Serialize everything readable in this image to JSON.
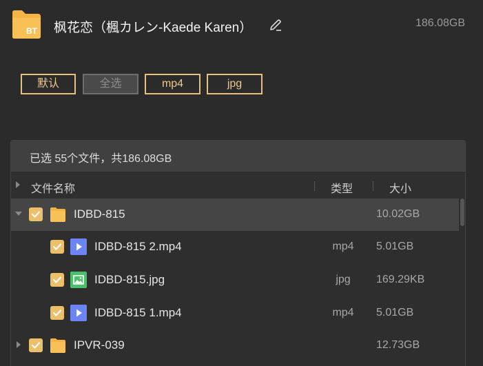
{
  "header": {
    "title": "枫花恋（楓カレン-Kaede Karen）",
    "total_size": "186.08GB",
    "folder_badge": "BT"
  },
  "filters": [
    {
      "label": "默认",
      "state": "active"
    },
    {
      "label": "全选",
      "state": "disabled"
    },
    {
      "label": "mp4",
      "state": "active"
    },
    {
      "label": "jpg",
      "state": "active"
    }
  ],
  "panel": {
    "summary": "已选 55个文件，共186.08GB",
    "columns": {
      "name": "文件名称",
      "type": "类型",
      "size": "大小"
    },
    "rows": [
      {
        "kind": "folder",
        "name": "IDBD-815",
        "type": "",
        "size": "10.02GB",
        "expanded": true,
        "checked": true,
        "level": 0
      },
      {
        "kind": "video",
        "name": "IDBD-815 2.mp4",
        "type": "mp4",
        "size": "5.01GB",
        "checked": true,
        "level": 1
      },
      {
        "kind": "image",
        "name": "IDBD-815.jpg",
        "type": "jpg",
        "size": "169.29KB",
        "checked": true,
        "level": 1
      },
      {
        "kind": "video",
        "name": "IDBD-815 1.mp4",
        "type": "mp4",
        "size": "5.01GB",
        "checked": true,
        "level": 1
      },
      {
        "kind": "folder",
        "name": "IPVR-039",
        "type": "",
        "size": "12.73GB",
        "expanded": false,
        "checked": true,
        "level": 0
      }
    ]
  },
  "colors": {
    "accent": "#ecbf6b",
    "folder": "#f5b544",
    "video_icon": "#6c84f4",
    "image_icon": "#4cbf6b"
  }
}
